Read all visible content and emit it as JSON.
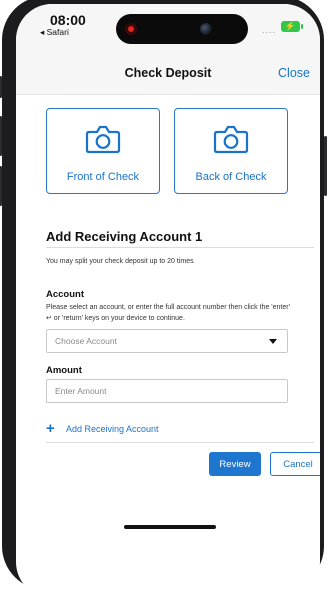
{
  "status_bar": {
    "time": "08:00",
    "back_app": "◂ Safari",
    "signal_dots": "....",
    "battery_icon": "battery-charging-icon",
    "battery_color": "#33c748"
  },
  "nav": {
    "title": "Check Deposit",
    "close_label": "Close"
  },
  "capture": {
    "front_label": "Front of Check",
    "back_label": "Back of Check",
    "icon": "camera-icon"
  },
  "form": {
    "section_title": "Add Receiving Account 1",
    "split_note": "You may split your check deposit up to 20 times",
    "account_label": "Account",
    "account_help": "Please select an account, or enter the full account number then click the 'enter' ↵ or 'return' keys on your device to continue.",
    "account_placeholder": "Choose Account",
    "amount_label": "Amount",
    "amount_placeholder": "Enter Amount",
    "add_account_label": "Add Receiving Account",
    "add_icon": "plus-icon"
  },
  "actions": {
    "review_label": "Review",
    "cancel_label": "Cancel"
  },
  "colors": {
    "accent": "#1a73c9",
    "button_bg": "#1f76cf",
    "nav_bg": "#f6f6f6"
  }
}
